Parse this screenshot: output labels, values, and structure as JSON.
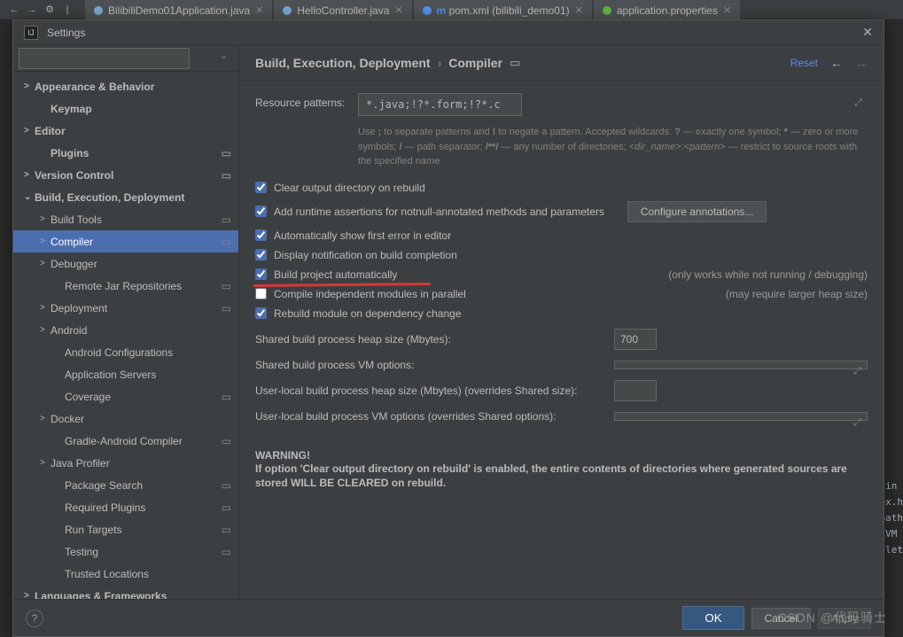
{
  "tabs": [
    {
      "icon_color": "#7aa7d4",
      "label": "BilibiliDemo01Application.java"
    },
    {
      "icon_color": "#7aa7d4",
      "label": "HelloController.java"
    },
    {
      "icon_color": "#5394ec",
      "prefix": "m",
      "label": "pom.xml (bilibili_demo01)"
    },
    {
      "icon_color": "#62b543",
      "label": "application.properties"
    }
  ],
  "dialog": {
    "title": "Settings"
  },
  "tree": [
    {
      "label": "Appearance & Behavior",
      "chev": ">",
      "bold": true
    },
    {
      "label": "Keymap",
      "pad": 1,
      "bold": true
    },
    {
      "label": "Editor",
      "chev": ">",
      "bold": true
    },
    {
      "label": "Plugins",
      "pad": 1,
      "bold": true,
      "cfg": true
    },
    {
      "label": "Version Control",
      "chev": ">",
      "bold": true,
      "cfg": true
    },
    {
      "label": "Build, Execution, Deployment",
      "chev": "⌄",
      "bold": true
    },
    {
      "label": "Build Tools",
      "chev": ">",
      "pad": 1,
      "cfg": true
    },
    {
      "label": "Compiler",
      "chev": ">",
      "pad": 1,
      "cfg": true,
      "selected": true
    },
    {
      "label": "Debugger",
      "chev": ">",
      "pad": 1
    },
    {
      "label": "Remote Jar Repositories",
      "pad": 2,
      "cfg": true
    },
    {
      "label": "Deployment",
      "chev": ">",
      "pad": 1,
      "cfg": true
    },
    {
      "label": "Android",
      "chev": ">",
      "pad": 1
    },
    {
      "label": "Android Configurations",
      "pad": 2
    },
    {
      "label": "Application Servers",
      "pad": 2
    },
    {
      "label": "Coverage",
      "pad": 2,
      "cfg": true
    },
    {
      "label": "Docker",
      "chev": ">",
      "pad": 1
    },
    {
      "label": "Gradle-Android Compiler",
      "pad": 2,
      "cfg": true
    },
    {
      "label": "Java Profiler",
      "chev": ">",
      "pad": 1
    },
    {
      "label": "Package Search",
      "pad": 2,
      "cfg": true
    },
    {
      "label": "Required Plugins",
      "pad": 2,
      "cfg": true
    },
    {
      "label": "Run Targets",
      "pad": 2,
      "cfg": true
    },
    {
      "label": "Testing",
      "pad": 2,
      "cfg": true
    },
    {
      "label": "Trusted Locations",
      "pad": 2
    },
    {
      "label": "Languages & Frameworks",
      "chev": ">",
      "bold": true
    }
  ],
  "header": {
    "crumb1": "Build, Execution, Deployment",
    "crumb2": "Compiler",
    "reset": "Reset"
  },
  "content": {
    "patterns_label": "Resource patterns:",
    "patterns_value": "*.java;!?*.form;!?*.class;!?*.groovy;!?*.scala;!?*.flex;!?*.kt;!?*.clj;!?*.aj",
    "help": "Use ; to separate patterns and ! to negate a pattern. Accepted wildcards: ? — exactly one symbol; * — zero or more symbols; / — path separator; /**/ — any number of directories; <dir_name>:<pattern> — restrict to source roots with the specified name",
    "cb1": "Clear output directory on rebuild",
    "cb2": "Add runtime assertions for notnull-annotated methods and parameters",
    "btn_configure": "Configure annotations...",
    "cb3": "Automatically show first error in editor",
    "cb4": "Display notification on build completion",
    "cb5": "Build project automatically",
    "cb5_note": "(only works while not running / debugging)",
    "cb6": "Compile independent modules in parallel",
    "cb6_note": "(may require larger heap size)",
    "cb7": "Rebuild module on dependency change",
    "f1_l": "Shared build process heap size (Mbytes):",
    "f1_v": "700",
    "f2_l": "Shared build process VM options:",
    "f3_l": "User-local build process heap size (Mbytes) (overrides Shared size):",
    "f4_l": "User-local build process VM options (overrides Shared options):",
    "warn_title": "WARNING!",
    "warn_body": "If option 'Clear output directory on rebuild' is enabled, the entire contents of directories where generated sources are stored WILL BE CLEARED on rebuild."
  },
  "footer": {
    "ok": "OK",
    "cancel": "Cancel",
    "apply": "Apply"
  },
  "watermark": "CSDN @代码骑士",
  "code_frag": " in\nex.h\npath\nJVM\nvlet"
}
